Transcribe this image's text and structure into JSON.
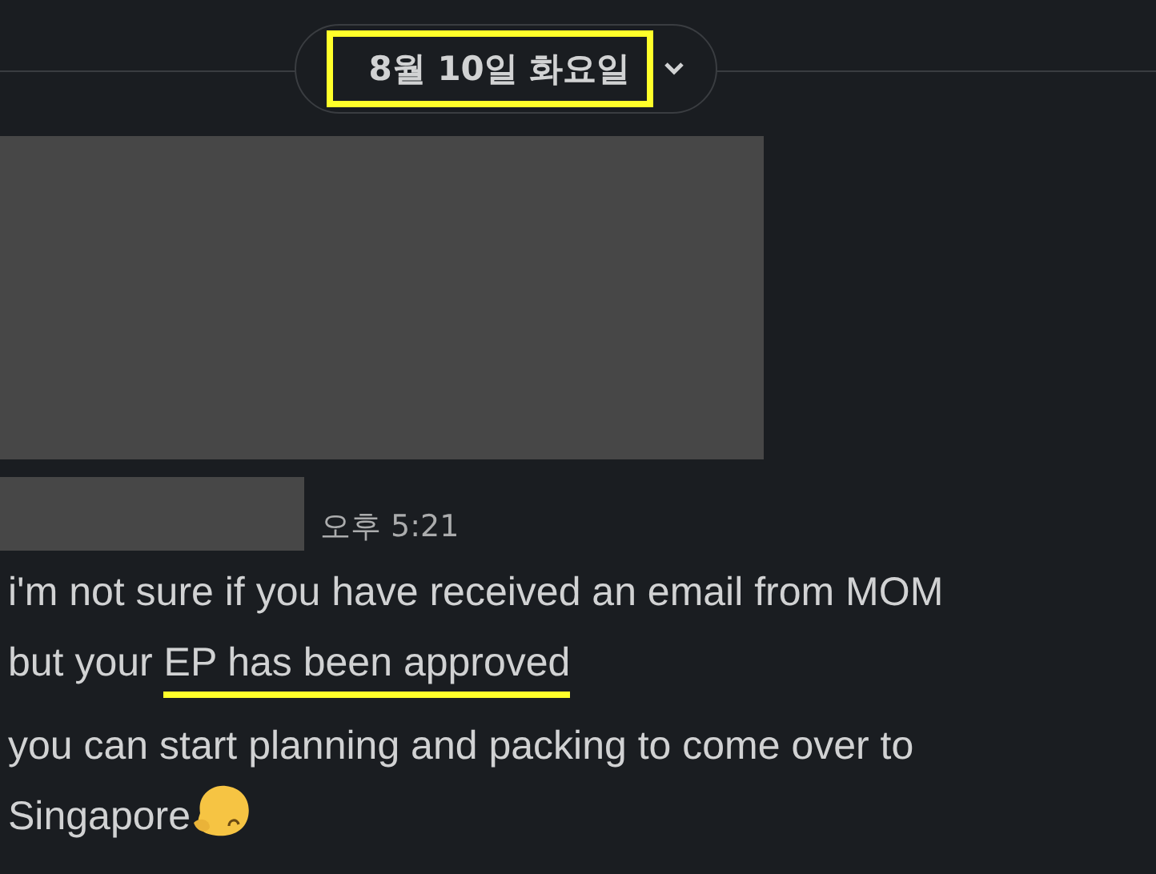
{
  "date_divider": {
    "label": "8월 10일 화요일",
    "highlighted": true
  },
  "attachment": {
    "kind": "redacted"
  },
  "message": {
    "sender": {
      "kind": "redacted"
    },
    "time": "오후 5:21",
    "paragraphs": [
      {
        "segments": [
          {
            "text": "i'm not sure if you have received an email from MOM but your ",
            "marked": false
          },
          {
            "text": "EP has been approved",
            "marked": true
          }
        ]
      },
      {
        "segments": [
          {
            "text": "you can start planning and packing to come over to Singapore",
            "marked": false
          }
        ],
        "emoji": true
      }
    ]
  }
}
